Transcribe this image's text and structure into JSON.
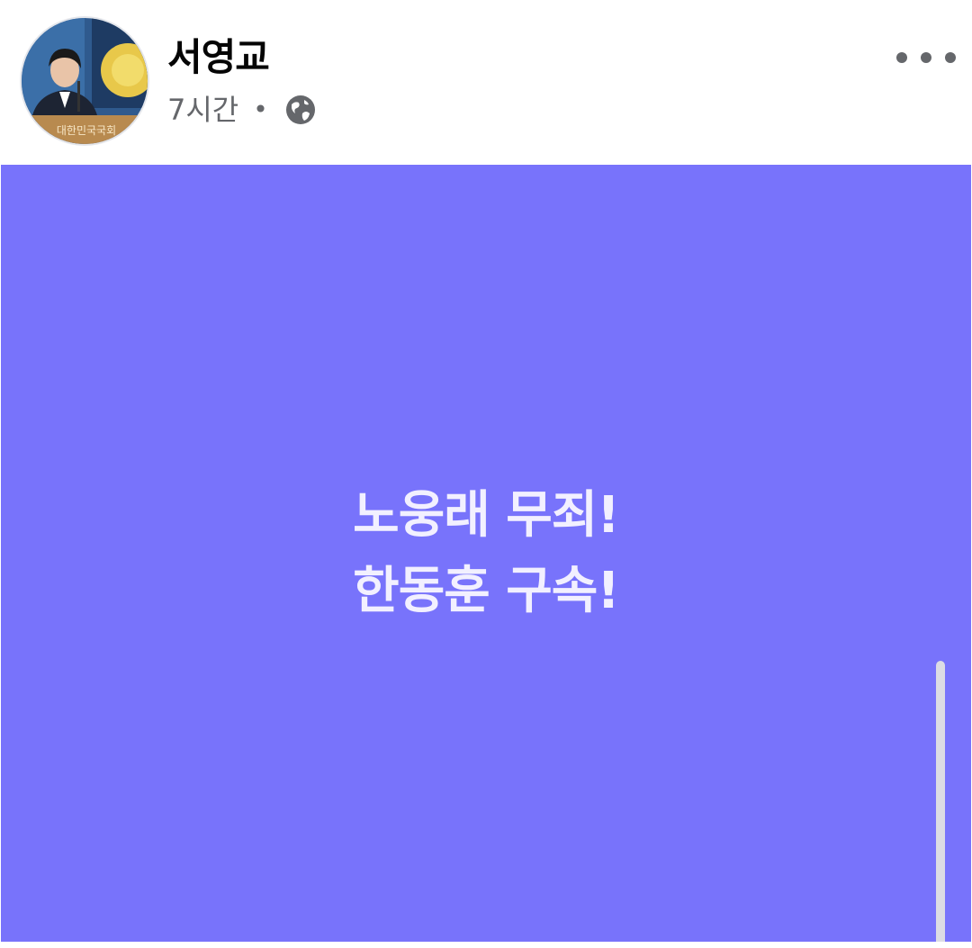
{
  "post": {
    "author": {
      "name": "서영교",
      "avatar_caption": "대한민국국회",
      "avatar_icon": "profile-photo"
    },
    "meta": {
      "time": "7시간",
      "separator": "•",
      "audience_icon": "globe-icon"
    },
    "more_icon": "more-horizontal-icon",
    "card": {
      "background_color": "#7873fb",
      "text_color": "#f2f0ff",
      "lines": [
        "노웅래 무죄!",
        "한동훈 구속!"
      ]
    }
  }
}
